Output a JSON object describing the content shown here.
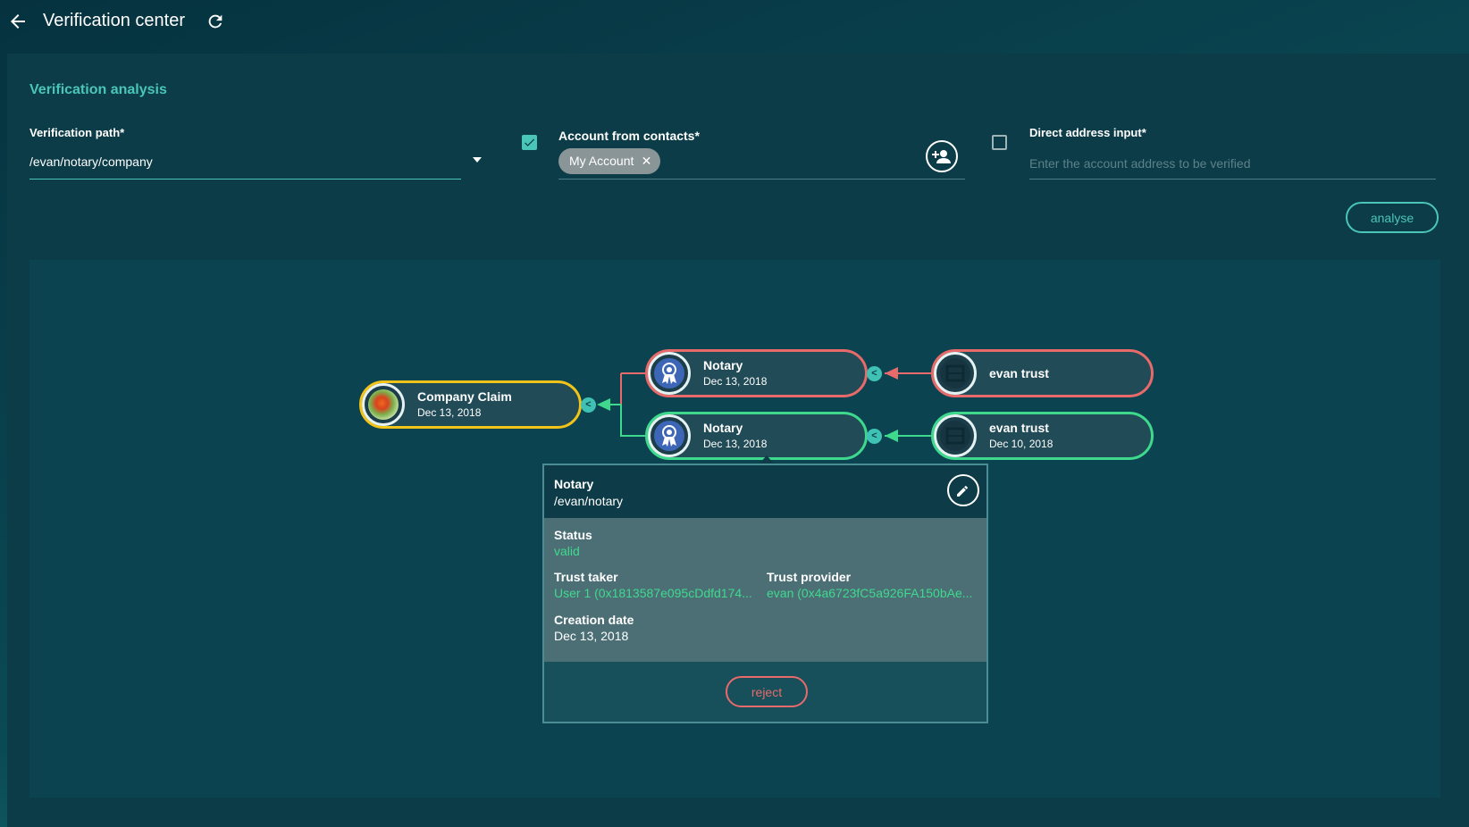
{
  "header": {
    "title": "Verification center",
    "back_icon": "arrow-left-icon",
    "refresh_icon": "refresh-icon"
  },
  "analysis": {
    "section_title": "Verification analysis",
    "verification_path": {
      "label": "Verification path*",
      "value": "/evan/notary/company"
    },
    "account_from_contacts": {
      "checked": true,
      "label": "Account from contacts*",
      "chip": "My Account",
      "chip_remove": "✕",
      "add_contact_icon": "person-add-icon"
    },
    "direct_address": {
      "checked": false,
      "label": "Direct address input*",
      "placeholder": "Enter the account address to be verified"
    },
    "analyse_button": "analyse"
  },
  "graph": {
    "colors": {
      "yellow": "#f2c318",
      "red": "#e86a6a",
      "green": "#3fd98e",
      "connector": "#3fc2b3"
    },
    "connector_glyph": "<",
    "nodes": {
      "company_claim": {
        "title": "Company Claim",
        "date": "Dec 13, 2018",
        "status": "yellow"
      },
      "notary_top": {
        "title": "Notary",
        "date": "Dec 13, 2018",
        "status": "red"
      },
      "evan_top": {
        "title": "evan trust",
        "status": "red"
      },
      "notary_bottom": {
        "title": "Notary",
        "date": "Dec 13, 2018",
        "status": "green"
      },
      "evan_bottom": {
        "title": "evan trust",
        "date": "Dec 10, 2018",
        "status": "green"
      }
    }
  },
  "popup": {
    "title": "Notary",
    "path": "/evan/notary",
    "edit_icon": "pencil-icon",
    "status_label": "Status",
    "status_value": "valid",
    "trust_taker_label": "Trust taker",
    "trust_taker_value": "User 1 (0x1813587e095cDdfd174...",
    "trust_provider_label": "Trust provider",
    "trust_provider_value": "evan (0x4a6723fC5a926FA150bAe...",
    "creation_date_label": "Creation date",
    "creation_date_value": "Dec 13, 2018",
    "reject_button": "reject"
  }
}
